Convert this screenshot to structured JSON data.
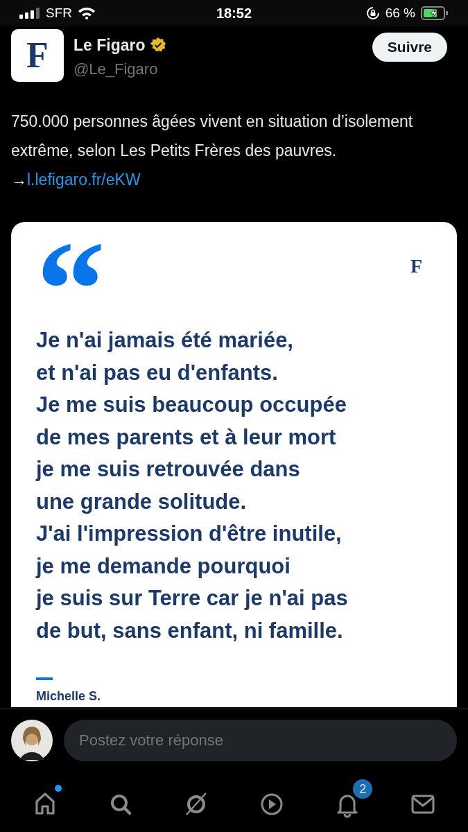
{
  "status_bar": {
    "carrier": "SFR",
    "time": "18:52",
    "battery": "66 %"
  },
  "author": {
    "logo_letter": "F",
    "name": "Le Figaro",
    "handle": "@Le_Figaro",
    "verified": true,
    "follow_button": "Suivre"
  },
  "tweet": {
    "text": "750.000 personnes âgées vivent en situation d’isolement extrême, selon Les Petits Frères des pauvres. →",
    "link": "l.lefigaro.fr/eKW"
  },
  "card": {
    "quote_mark": "“",
    "logo_letter": "F",
    "quote": "Je n'ai jamais été mariée,\net n'ai pas eu d'enfants.\nJe me suis beaucoup occupée\nde mes parents et à leur mort\nje me suis retrouvée dans\nune grande solitude.\nJ'ai l'impression d'être inutile,\nje me demande pourquoi\nje suis sur Terre car je n'ai pas\nde but, sans enfant, ni famille.",
    "attribution": "Michelle S."
  },
  "reply": {
    "placeholder": "Postez votre réponse"
  },
  "tab_bar": [
    {
      "kind": "home",
      "unread_dot": true
    },
    {
      "kind": "search"
    },
    {
      "kind": "grok"
    },
    {
      "kind": "video"
    },
    {
      "kind": "notifications",
      "badge": "2"
    },
    {
      "kind": "messages"
    }
  ]
}
